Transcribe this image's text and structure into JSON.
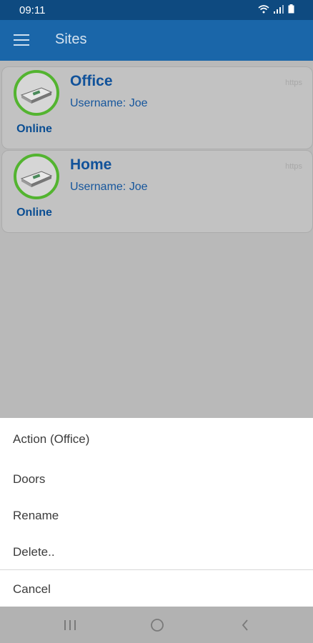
{
  "status_bar": {
    "time": "09:11"
  },
  "app_bar": {
    "title": "Sites"
  },
  "sites": [
    {
      "name": "Office",
      "username": "Username: Joe",
      "status": "Online",
      "url": "https"
    },
    {
      "name": "Home",
      "username": "Username: Joe",
      "status": "Online",
      "url": "https"
    }
  ],
  "action_sheet": {
    "title": "Action (Office)",
    "items": [
      "Doors",
      "Rename",
      "Delete.."
    ],
    "cancel": "Cancel"
  },
  "colors": {
    "app_bar": "#1a66a9",
    "status_bar": "#0e4a80",
    "online_ring": "#53b430",
    "site_text": "#11529a"
  }
}
